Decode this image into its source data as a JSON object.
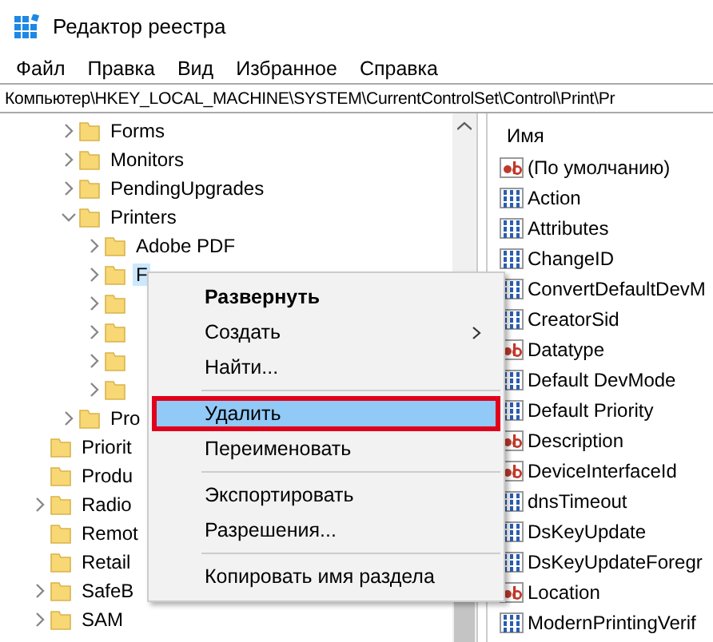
{
  "window": {
    "title": "Редактор реестра"
  },
  "menu_bar": [
    "Файл",
    "Правка",
    "Вид",
    "Избранное",
    "Справка"
  ],
  "address_bar": {
    "value": "Компьютер\\HKEY_LOCAL_MACHINE\\SYSTEM\\CurrentControlSet\\Control\\Print\\Pr"
  },
  "tree": {
    "items": [
      {
        "label": "Forms",
        "expandable": true,
        "expanded": false,
        "selected": false
      },
      {
        "label": "Monitors",
        "expandable": true,
        "expanded": false,
        "selected": false
      },
      {
        "label": "PendingUpgrades",
        "expandable": true,
        "expanded": false,
        "selected": false
      },
      {
        "label": "Printers",
        "expandable": true,
        "expanded": true,
        "selected": false,
        "children": [
          {
            "label": "Adobe PDF",
            "expandable": true,
            "expanded": false,
            "selected": false
          },
          {
            "label": "F",
            "expandable": true,
            "expanded": false,
            "selected": true
          },
          {
            "expandable": true,
            "expanded": false
          },
          {
            "expandable": true,
            "expanded": false
          },
          {
            "expandable": true,
            "expanded": false
          },
          {
            "expandable": true,
            "expanded": false
          }
        ]
      },
      {
        "label": "Pro",
        "expandable": true,
        "expanded": false,
        "selected": false
      }
    ],
    "parent_level_items": [
      {
        "label": "Priorit",
        "expandable": false,
        "selected": false
      },
      {
        "label": "Produ",
        "expandable": false,
        "selected": false
      },
      {
        "label": "Radio",
        "expandable": true,
        "expanded": false,
        "selected": false
      },
      {
        "label": "Remot",
        "expandable": false,
        "selected": false
      },
      {
        "label": "Retail",
        "expandable": false,
        "selected": false
      },
      {
        "label": "SafeB",
        "expandable": true,
        "expanded": false,
        "selected": false
      },
      {
        "label": "SAM",
        "expandable": true,
        "expanded": false,
        "selected": false
      }
    ]
  },
  "values": {
    "column": "Имя",
    "rows": [
      {
        "name": "(По умолчанию)",
        "kind": "string"
      },
      {
        "name": "Action",
        "kind": "binary"
      },
      {
        "name": "Attributes",
        "kind": "binary"
      },
      {
        "name": "ChangeID",
        "kind": "binary"
      },
      {
        "name": "ConvertDefaultDevM",
        "kind": "binary"
      },
      {
        "name": "CreatorSid",
        "kind": "binary"
      },
      {
        "name": "Datatype",
        "kind": "string"
      },
      {
        "name": "Default DevMode",
        "kind": "binary"
      },
      {
        "name": "Default Priority",
        "kind": "binary"
      },
      {
        "name": "Description",
        "kind": "string"
      },
      {
        "name": "DeviceInterfaceId",
        "kind": "string"
      },
      {
        "name": "dnsTimeout",
        "kind": "binary"
      },
      {
        "name": "DsKeyUpdate",
        "kind": "binary"
      },
      {
        "name": "DsKeyUpdateForegr",
        "kind": "binary"
      },
      {
        "name": "Location",
        "kind": "string"
      },
      {
        "name": "ModernPrintingVerif",
        "kind": "binary"
      }
    ]
  },
  "context_menu": [
    {
      "kind": "item",
      "label": "Развернуть",
      "bold": true,
      "submenu": false,
      "selected": false
    },
    {
      "kind": "item",
      "label": "Создать",
      "bold": false,
      "submenu": true,
      "selected": false
    },
    {
      "kind": "item",
      "label": "Найти...",
      "bold": false,
      "submenu": false,
      "selected": false
    },
    {
      "kind": "separator"
    },
    {
      "kind": "item",
      "label": "Удалить",
      "bold": false,
      "submenu": false,
      "selected": true
    },
    {
      "kind": "item",
      "label": "Переименовать",
      "bold": false,
      "submenu": false,
      "selected": false
    },
    {
      "kind": "separator"
    },
    {
      "kind": "item",
      "label": "Экспортировать",
      "bold": false,
      "submenu": false,
      "selected": false
    },
    {
      "kind": "item",
      "label": "Разрешения...",
      "bold": false,
      "submenu": false,
      "selected": false
    },
    {
      "kind": "separator"
    },
    {
      "kind": "item",
      "label": "Копировать имя раздела",
      "bold": false,
      "submenu": false,
      "selected": false
    }
  ]
}
